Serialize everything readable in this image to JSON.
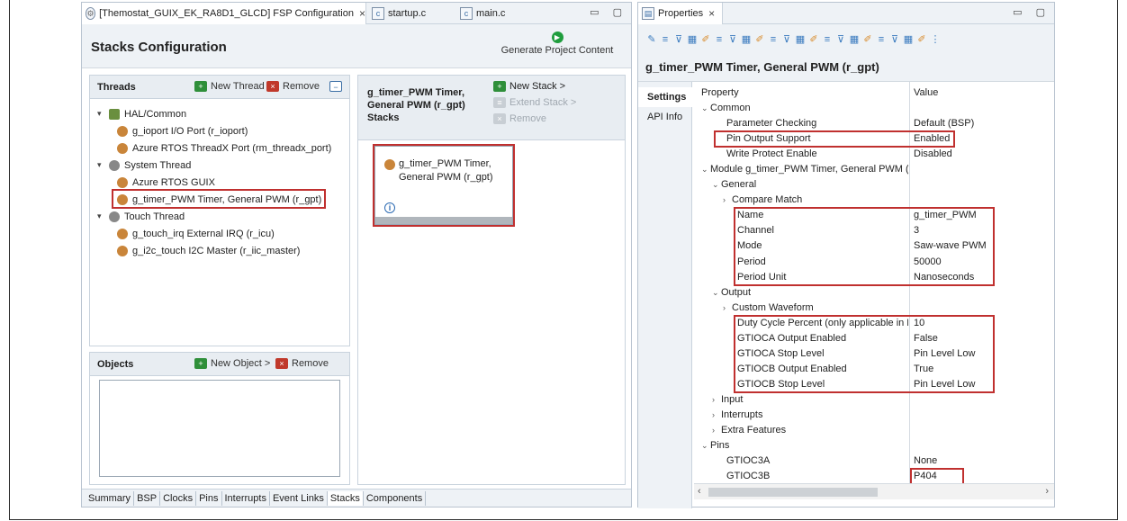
{
  "editor": {
    "tabs": [
      {
        "label": "[Themostat_GUIX_EK_RA8D1_GLCD] FSP Configuration",
        "close": "×",
        "icon": "gear-icon"
      },
      {
        "label": "startup.c",
        "icon": "c-file-icon"
      },
      {
        "label": "main.c",
        "icon": "c-file-icon"
      }
    ],
    "window_controls": "▭ ▢",
    "title": "Stacks Configuration",
    "generate_button": "Generate Project Content",
    "threads": {
      "title": "Threads",
      "new_thread": "New Thread",
      "remove": "Remove",
      "tree": [
        {
          "label": "HAL/Common",
          "level": 0,
          "kind": "hal"
        },
        {
          "label": "g_ioport I/O Port (r_ioport)",
          "level": 1,
          "kind": "mod"
        },
        {
          "label": "Azure RTOS ThreadX Port (rm_threadx_port)",
          "level": 1,
          "kind": "mod"
        },
        {
          "label": "System Thread",
          "level": 0,
          "kind": "gear"
        },
        {
          "label": "Azure RTOS GUIX",
          "level": 1,
          "kind": "mod"
        },
        {
          "label": "g_timer_PWM Timer, General PWM (r_gpt)",
          "level": 1,
          "kind": "mod",
          "selected": true
        },
        {
          "label": "Touch Thread",
          "level": 0,
          "kind": "gear"
        },
        {
          "label": "g_touch_irq External IRQ (r_icu)",
          "level": 1,
          "kind": "mod"
        },
        {
          "label": "g_i2c_touch I2C Master (r_iic_master)",
          "level": 1,
          "kind": "mod"
        }
      ]
    },
    "objects": {
      "title": "Objects",
      "new_object": "New Object >",
      "remove": "Remove"
    },
    "stacks": {
      "title_line1": "g_timer_PWM Timer,",
      "title_line2": "General PWM (r_gpt)",
      "title_line3": "Stacks",
      "new_stack": "New Stack >",
      "extend_stack": "Extend Stack >",
      "remove": "Remove",
      "card_line1": "g_timer_PWM Timer,",
      "card_line2": "General PWM (r_gpt)"
    },
    "bottom_tabs": [
      "Summary",
      "BSP",
      "Clocks",
      "Pins",
      "Interrupts",
      "Event Links",
      "Stacks",
      "Components"
    ],
    "active_bottom_tab": "Stacks"
  },
  "properties": {
    "tab_label": "Properties",
    "close": "×",
    "window_controls": "▭ ▢",
    "title": "g_timer_PWM Timer, General PWM (r_gpt)",
    "side_tabs": [
      "Settings",
      "API Info"
    ],
    "col_property": "Property",
    "col_value": "Value",
    "rows": [
      {
        "p": "Common",
        "v": "",
        "indent": 0,
        "caret": "v"
      },
      {
        "p": "Parameter Checking",
        "v": "Default (BSP)",
        "indent": 2,
        "caret": ""
      },
      {
        "p": "Pin Output Support",
        "v": "Enabled",
        "indent": 2,
        "caret": ""
      },
      {
        "p": "Write Protect Enable",
        "v": "Disabled",
        "indent": 2,
        "caret": ""
      },
      {
        "p": "Module g_timer_PWM Timer, General PWM (r_gpt)",
        "v": "",
        "indent": 0,
        "caret": "v"
      },
      {
        "p": "General",
        "v": "",
        "indent": 1,
        "caret": "v"
      },
      {
        "p": "Compare Match",
        "v": "",
        "indent": 2,
        "caret": ">"
      },
      {
        "p": "Name",
        "v": "g_timer_PWM",
        "indent": 3,
        "caret": ""
      },
      {
        "p": "Channel",
        "v": "3",
        "indent": 3,
        "caret": ""
      },
      {
        "p": "Mode",
        "v": "Saw-wave PWM",
        "indent": 3,
        "caret": ""
      },
      {
        "p": "Period",
        "v": "50000",
        "indent": 3,
        "caret": ""
      },
      {
        "p": "Period Unit",
        "v": "Nanoseconds",
        "indent": 3,
        "caret": ""
      },
      {
        "p": "Output",
        "v": "",
        "indent": 1,
        "caret": "v"
      },
      {
        "p": "Custom Waveform",
        "v": "",
        "indent": 2,
        "caret": ">"
      },
      {
        "p": "Duty Cycle Percent (only applicable in PWM mode)",
        "v": "10",
        "indent": 3,
        "caret": ""
      },
      {
        "p": "GTIOCA Output Enabled",
        "v": "False",
        "indent": 3,
        "caret": ""
      },
      {
        "p": "GTIOCA Stop Level",
        "v": "Pin Level Low",
        "indent": 3,
        "caret": ""
      },
      {
        "p": "GTIOCB Output Enabled",
        "v": "True",
        "indent": 3,
        "caret": ""
      },
      {
        "p": "GTIOCB Stop Level",
        "v": "Pin Level Low",
        "indent": 3,
        "caret": ""
      },
      {
        "p": "Input",
        "v": "",
        "indent": 1,
        "caret": ">"
      },
      {
        "p": "Interrupts",
        "v": "",
        "indent": 1,
        "caret": ">"
      },
      {
        "p": "Extra Features",
        "v": "",
        "indent": 1,
        "caret": ">"
      },
      {
        "p": "Pins",
        "v": "",
        "indent": 0,
        "caret": "v"
      },
      {
        "p": "GTIOC3A",
        "v": "None",
        "indent": 2,
        "caret": ""
      },
      {
        "p": "GTIOC3B",
        "v": "P404",
        "indent": 2,
        "caret": ""
      }
    ]
  },
  "colors": {
    "highlight_border": "#c0302f",
    "panel_bg": "#eef2f6"
  }
}
